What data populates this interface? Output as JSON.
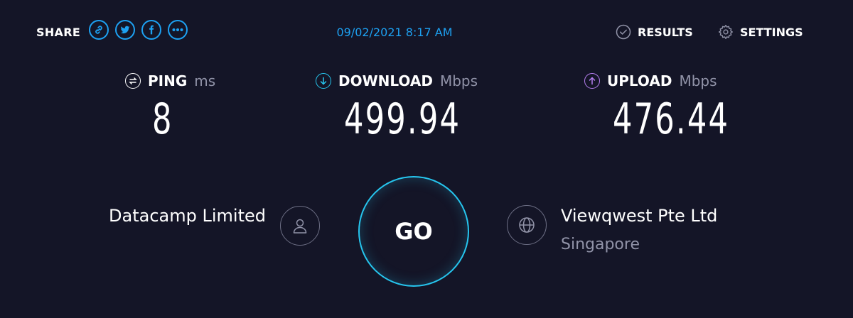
{
  "header": {
    "share_label": "SHARE",
    "share_icons": [
      "link-icon",
      "twitter-icon",
      "facebook-icon",
      "more-icon"
    ],
    "datetime": "09/02/2021 8:17 AM",
    "results_label": "RESULTS",
    "settings_label": "SETTINGS"
  },
  "metrics": {
    "ping": {
      "label": "PING",
      "unit": "ms",
      "value": "8"
    },
    "download": {
      "label": "DOWNLOAD",
      "unit": "Mbps",
      "value": "499.94"
    },
    "upload": {
      "label": "UPLOAD",
      "unit": "Mbps",
      "value": "476.44"
    }
  },
  "connection": {
    "isp": "Datacamp Limited",
    "go_label": "GO",
    "server_name": "Viewqwest Pte Ltd",
    "server_location": "Singapore"
  },
  "colors": {
    "background": "#141527",
    "accent": "#1da1f2",
    "go_ring": "#26c6ef",
    "download": "#26c6ef",
    "upload": "#b67ff0",
    "muted": "#9193a8"
  }
}
